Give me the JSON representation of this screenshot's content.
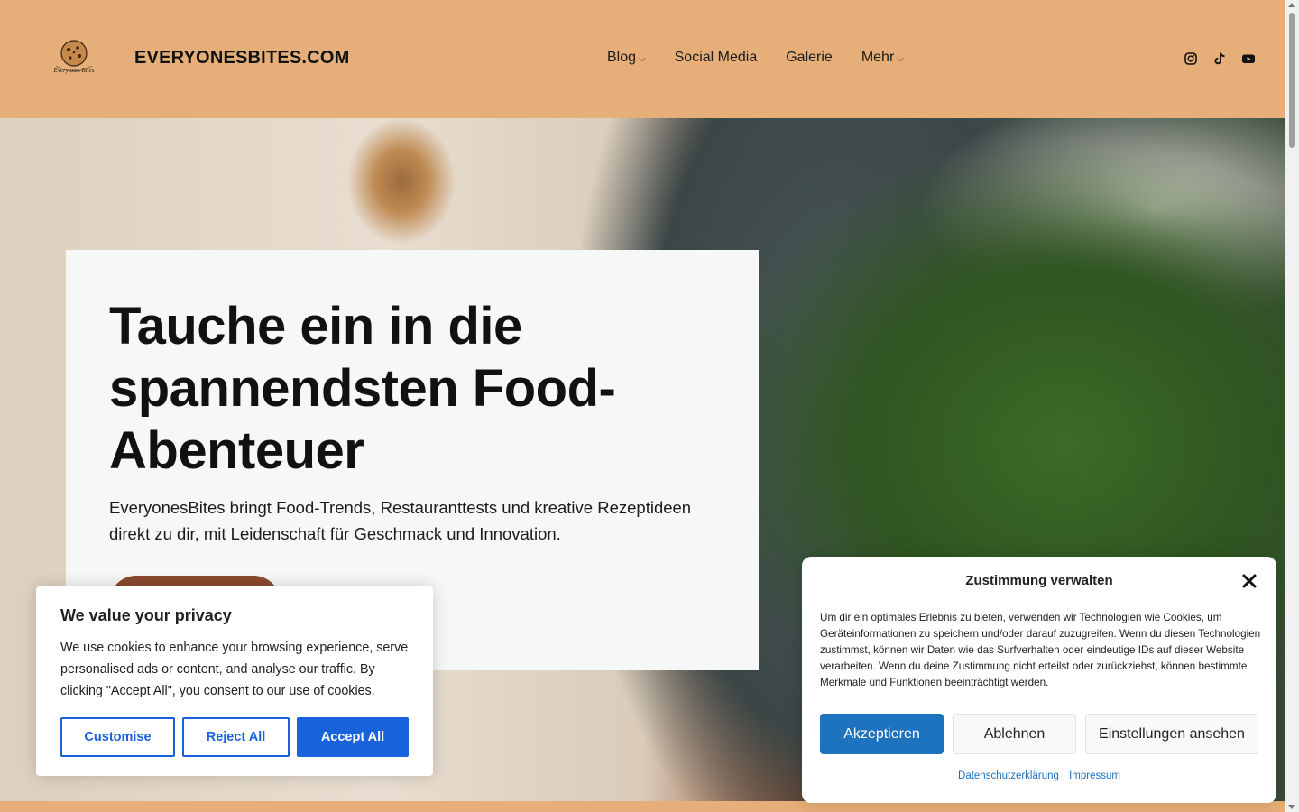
{
  "header": {
    "site_title": "EVERYONESBITES.COM",
    "logo_text": "Everyones Bites",
    "nav": [
      {
        "label": "Blog",
        "has_dropdown": true
      },
      {
        "label": "Social Media",
        "has_dropdown": false
      },
      {
        "label": "Galerie",
        "has_dropdown": false
      },
      {
        "label": "Mehr",
        "has_dropdown": true
      }
    ],
    "dropdown_glyph": "⌵",
    "social_icons": [
      "instagram-icon",
      "tiktok-icon",
      "youtube-icon"
    ],
    "background_color": "#e6ae78"
  },
  "hero": {
    "title": "Tauche ein in die spannendsten Food-Abenteuer",
    "text": "EveryonesBites bringt Food-Trends, Restauranttests und kreative Rezeptideen direkt zu dir, mit Leidenschaft für Geschmack und Innovation.",
    "button_color": "#8a4a2c"
  },
  "cookie_banner": {
    "title": "We value your privacy",
    "text": "We use cookies to enhance your browsing experience, serve personalised ads or content, and analyse our traffic. By clicking \"Accept All\", you consent to our use of cookies.",
    "customise_label": "Customise",
    "reject_label": "Reject All",
    "accept_label": "Accept All",
    "accent_color": "#1863dc"
  },
  "consent_dialog": {
    "title": "Zustimmung verwalten",
    "text": "Um dir ein optimales Erlebnis zu bieten, verwenden wir Technologien wie Cookies, um Geräteinformationen zu speichern und/oder darauf zuzugreifen. Wenn du diesen Technologien zustimmst, können wir Daten wie das Surfverhalten oder eindeutige IDs auf dieser Website verarbeiten. Wenn du deine Zustimmung nicht erteilst oder zurückziehst, können bestimmte Merkmale und Funktionen beeinträchtigt werden.",
    "accept_label": "Akzeptieren",
    "deny_label": "Ablehnen",
    "settings_label": "Einstellungen ansehen",
    "privacy_link": "Datenschutzerklärung",
    "imprint_link": "Impressum",
    "accent_color": "#1e73be"
  }
}
